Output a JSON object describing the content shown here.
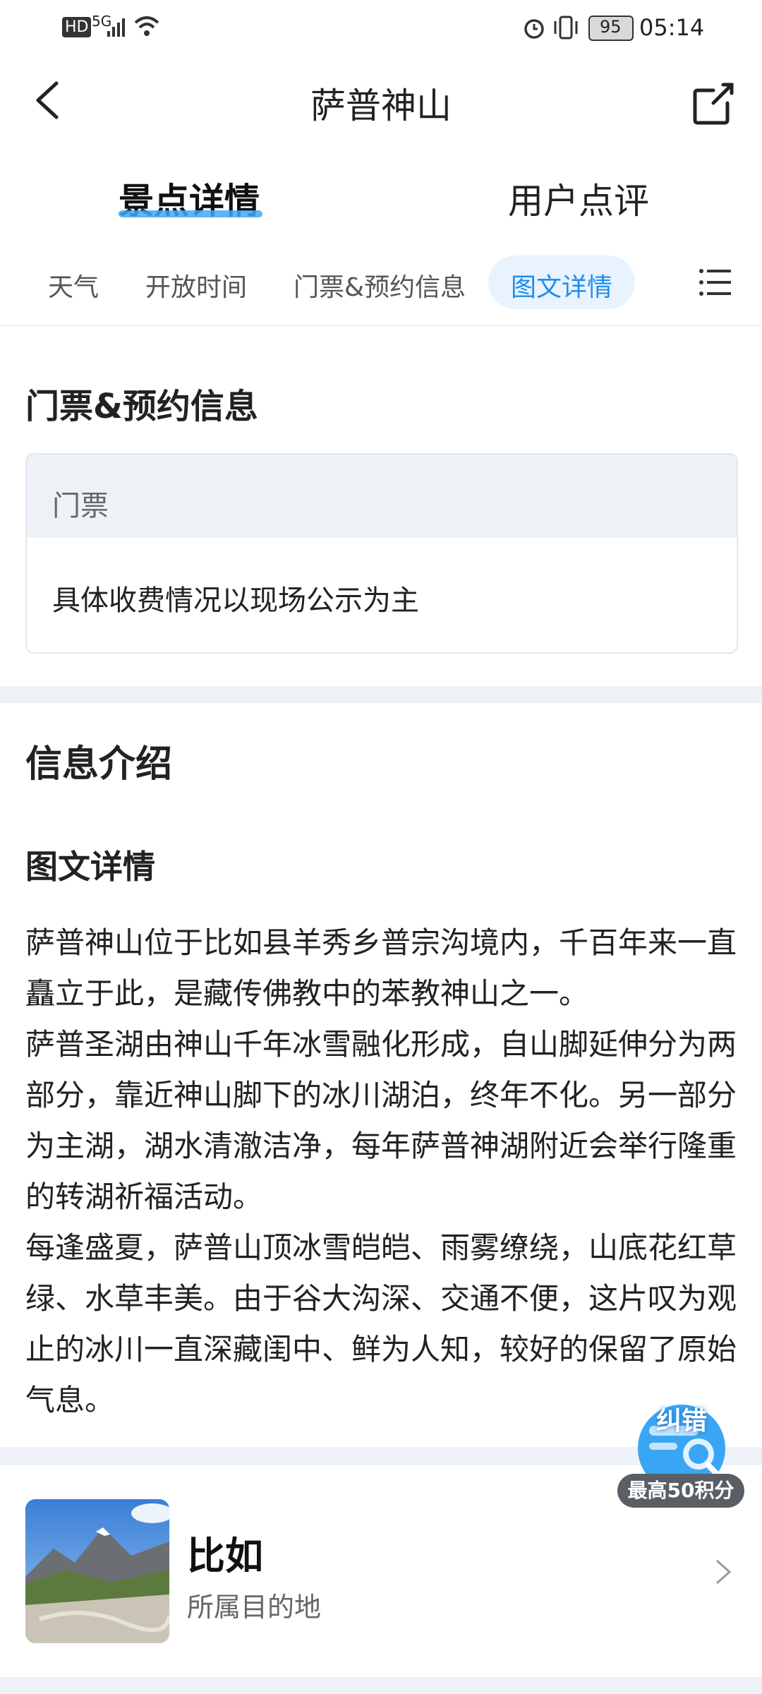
{
  "status_bar": {
    "time": "05:14",
    "battery": "95",
    "network": "5G",
    "hd": "HD"
  },
  "header": {
    "title": "萨普神山"
  },
  "main_tabs": [
    {
      "label": "景点详情",
      "active": true
    },
    {
      "label": "用户点评",
      "active": false
    }
  ],
  "sub_tabs": [
    {
      "label": "天气"
    },
    {
      "label": "开放时间"
    },
    {
      "label": "门票&预约信息"
    },
    {
      "label": "图文详情",
      "active": true
    }
  ],
  "ticket_section": {
    "title": "门票&预约信息",
    "box_header": "门票",
    "box_body": "具体收费情况以现场公示为主"
  },
  "info_section": {
    "title": "信息介绍",
    "subtitle": "图文详情",
    "paragraphs": [
      "萨普神山位于比如县羊秀乡普宗沟境内，千百年来一直矗立于此，是藏传佛教中的苯教神山之一。",
      "萨普圣湖由神山千年冰雪融化形成，自山脚延伸分为两部分，靠近神山脚下的冰川湖泊，终年不化。另一部分为主湖，湖水清澈洁净，每年萨普神湖附近会举行隆重的转湖祈福活动。",
      "每逢盛夏，萨普山顶冰雪皑皑、雨雾缭绕，山底花红草绿、水草丰美。由于谷大沟深、交通不便，这片叹为观止的冰川一直深藏闺中、鲜为人知，较好的保留了原始气息。"
    ]
  },
  "destination": {
    "name": "比如",
    "subtitle": "所属目的地"
  },
  "feedback_fab": {
    "label": "纠错",
    "badge": "最高50积分"
  },
  "colors": {
    "accent": "#1f8cf0",
    "underline": "#3fa8f5",
    "background": "#eef1f6"
  }
}
